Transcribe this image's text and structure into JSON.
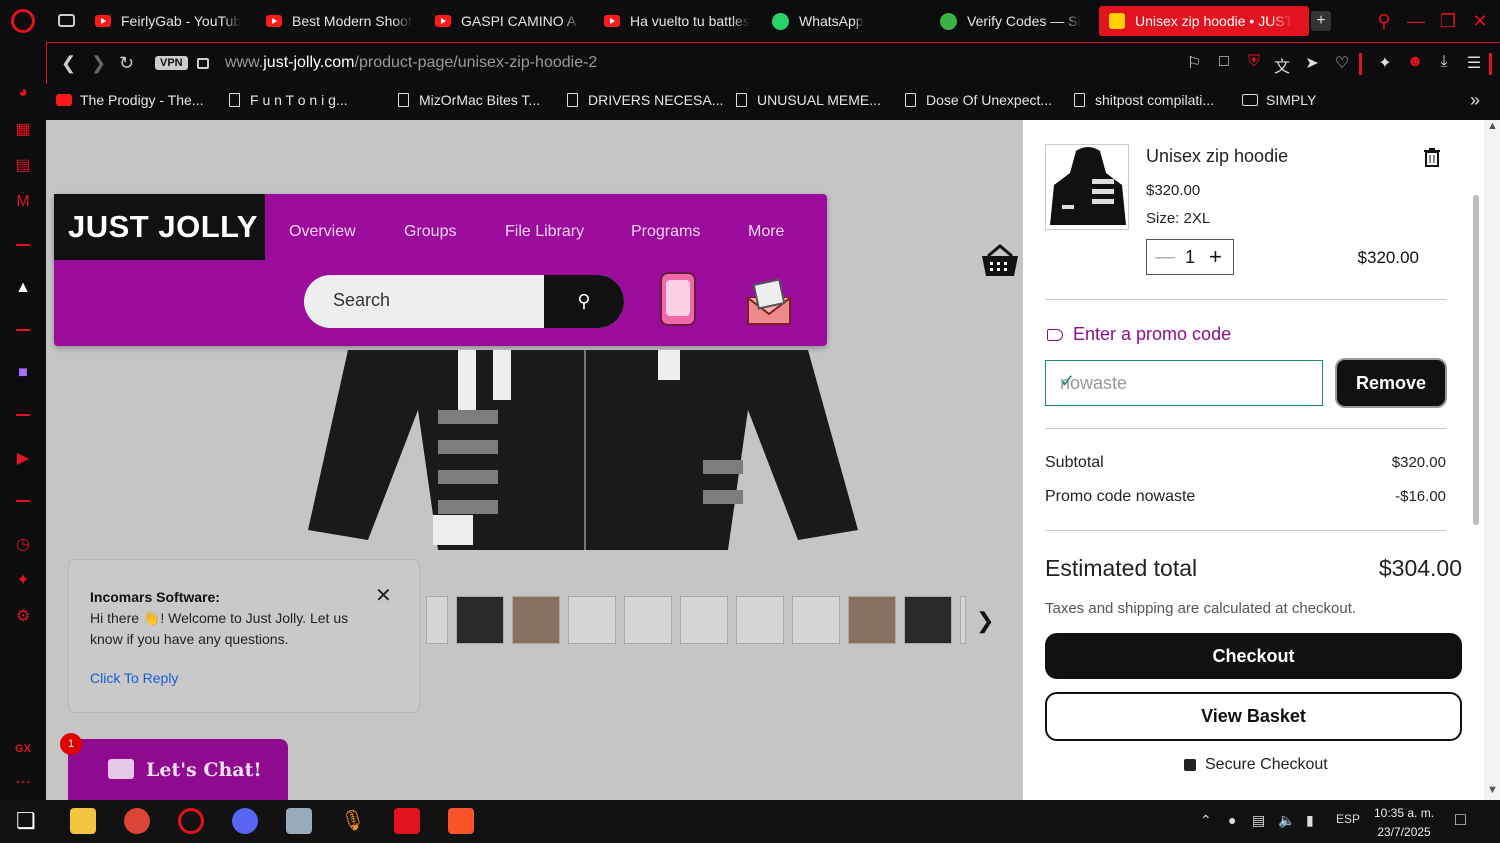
{
  "colors": {
    "accent": "#e2121f",
    "site_purple": "#9c0c9c",
    "promo_green": "#1d8a7a"
  },
  "tabs": [
    {
      "title": "FeirlyGab - YouTub",
      "icon": "youtube-icon"
    },
    {
      "title": "Best Modern Shoot",
      "icon": "youtube-icon"
    },
    {
      "title": "GASPI CAMINO A L",
      "icon": "youtube-icon"
    },
    {
      "title": "Ha vuelto tu battles",
      "icon": "youtube-icon"
    },
    {
      "title": "WhatsApp",
      "icon": "whatsapp-icon"
    },
    {
      "title": "Verify Codes — Si",
      "icon": "verify-icon"
    },
    {
      "title": "Unisex zip hoodie • JUST",
      "icon": "site-icon",
      "active": true
    }
  ],
  "address": {
    "vpn": "VPN",
    "url_prefix": "www.",
    "url_domain": "just-jolly.com",
    "url_path": "/product-page/unisex-zip-hoodie-2"
  },
  "bookmarks": [
    {
      "label": "The Prodigy - The...",
      "icon": "youtube-icon"
    },
    {
      "label": "F u n  T o n i  g...",
      "icon": "page-icon"
    },
    {
      "label": "MizOrMac Bites T...",
      "icon": "page-icon"
    },
    {
      "label": "DRIVERS NECESA...",
      "icon": "page-icon"
    },
    {
      "label": "UNUSUAL MEME...",
      "icon": "page-icon"
    },
    {
      "label": "Dose Of Unexpect...",
      "icon": "page-icon"
    },
    {
      "label": "shitpost compilati...",
      "icon": "page-icon"
    },
    {
      "label": "SIMPLY",
      "icon": "folder-icon"
    }
  ],
  "site": {
    "logo": "JUST JOLLY",
    "menu": [
      "Overview",
      "Groups",
      "File Library",
      "Programs",
      "More"
    ],
    "search_placeholder": "Search"
  },
  "chat": {
    "sender": "Incomars Software:",
    "message": "Hi there 👋! Welcome to Just Jolly. Let us know if you have any questions.",
    "reply": "Click To Reply",
    "button": "Let's Chat!",
    "badge": "1"
  },
  "cart": {
    "product_name": "Unisex zip hoodie",
    "price": "$320.00",
    "size": "Size: 2XL",
    "quantity": "1",
    "line_total": "$320.00",
    "promo_link": "Enter a promo code",
    "promo_value": "nowaste",
    "remove": "Remove",
    "subtotal_label": "Subtotal",
    "subtotal": "$320.00",
    "promo_label": "Promo code nowaste",
    "promo_amount": "-$16.00",
    "est_label": "Estimated total",
    "est_value": "$304.00",
    "taxes": "Taxes and shipping are calculated at checkout.",
    "checkout": "Checkout",
    "view_basket": "View Basket",
    "secure": "Secure Checkout"
  },
  "taskbar": {
    "lang": "ESP",
    "time": "10:35 a. m.",
    "date": "23/7/2025",
    "sidebar_gx": "GX"
  }
}
